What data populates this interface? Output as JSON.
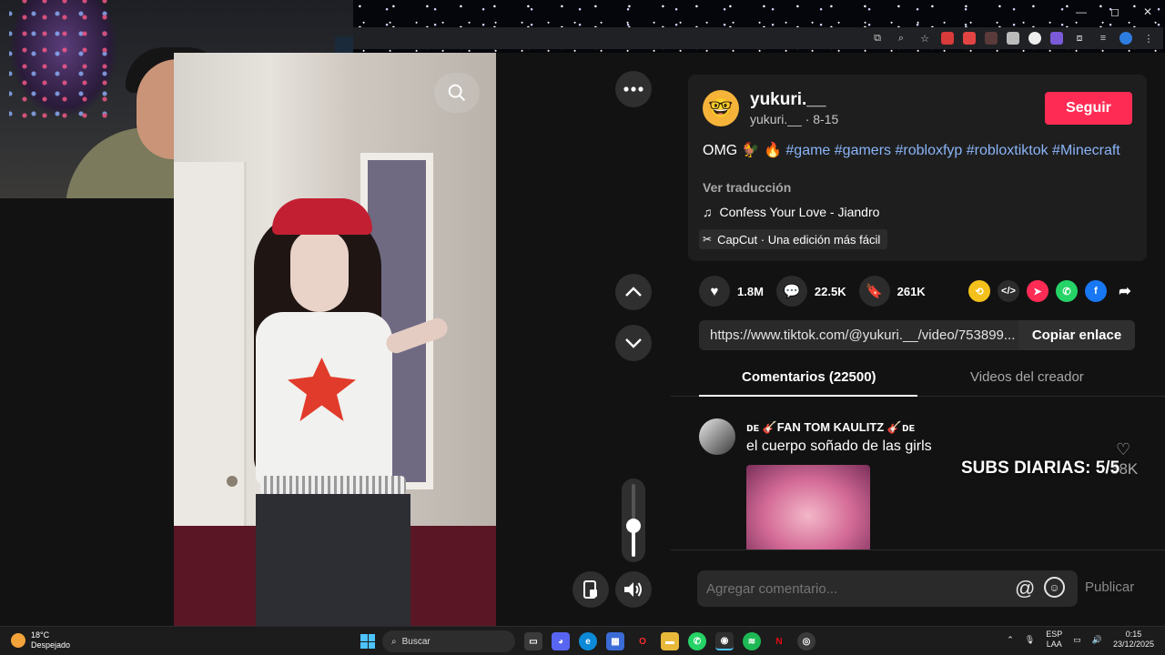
{
  "video": {
    "more_icon": "more-icon",
    "search_icon": "search-icon"
  },
  "creator": {
    "username": "yukuri.__",
    "handle_date": "yukuri.__ · 8-15",
    "follow_label": "Seguir"
  },
  "description": {
    "text": "OMG 🐓 🔥",
    "hashtags": [
      "#game",
      "#gamers",
      "#robloxfyp",
      "#robloxtiktok",
      "#Minecraft"
    ],
    "translate_label": "Ver traducción"
  },
  "music": {
    "title": "Confess Your Love - Jiandro"
  },
  "capcut": {
    "label": "CapCut · Una edición más fácil"
  },
  "stats": {
    "likes": "1.8M",
    "comments": "22.5K",
    "saves": "261K"
  },
  "share": {
    "link": "https://www.tiktok.com/@yukuri.__/video/753899...",
    "copy_label": "Copiar enlace"
  },
  "tabs": {
    "comments": "Comentarios (22500)",
    "creator_videos": "Videos del creador"
  },
  "comment": {
    "author": "ᴅᴇ 🎸FAN TOM KAULITZ 🎸ᴅᴇ",
    "text": "el cuerpo soñado de las girls",
    "likes": "38K"
  },
  "overlay": {
    "subs": "SUBS DIARIAS: 5/5"
  },
  "comment_box": {
    "placeholder": "Agregar comentario...",
    "publish_label": "Publicar"
  },
  "taskbar": {
    "weather_temp": "18°C",
    "weather_desc": "Despejado",
    "search_label": "Buscar",
    "lang_1": "ESP",
    "lang_2": "LAA",
    "time": "0:15",
    "date": "23/12/2025"
  },
  "colors": {
    "accent": "#fe2c55",
    "hashtag": "#8ab4f8",
    "panel": "#121212"
  }
}
